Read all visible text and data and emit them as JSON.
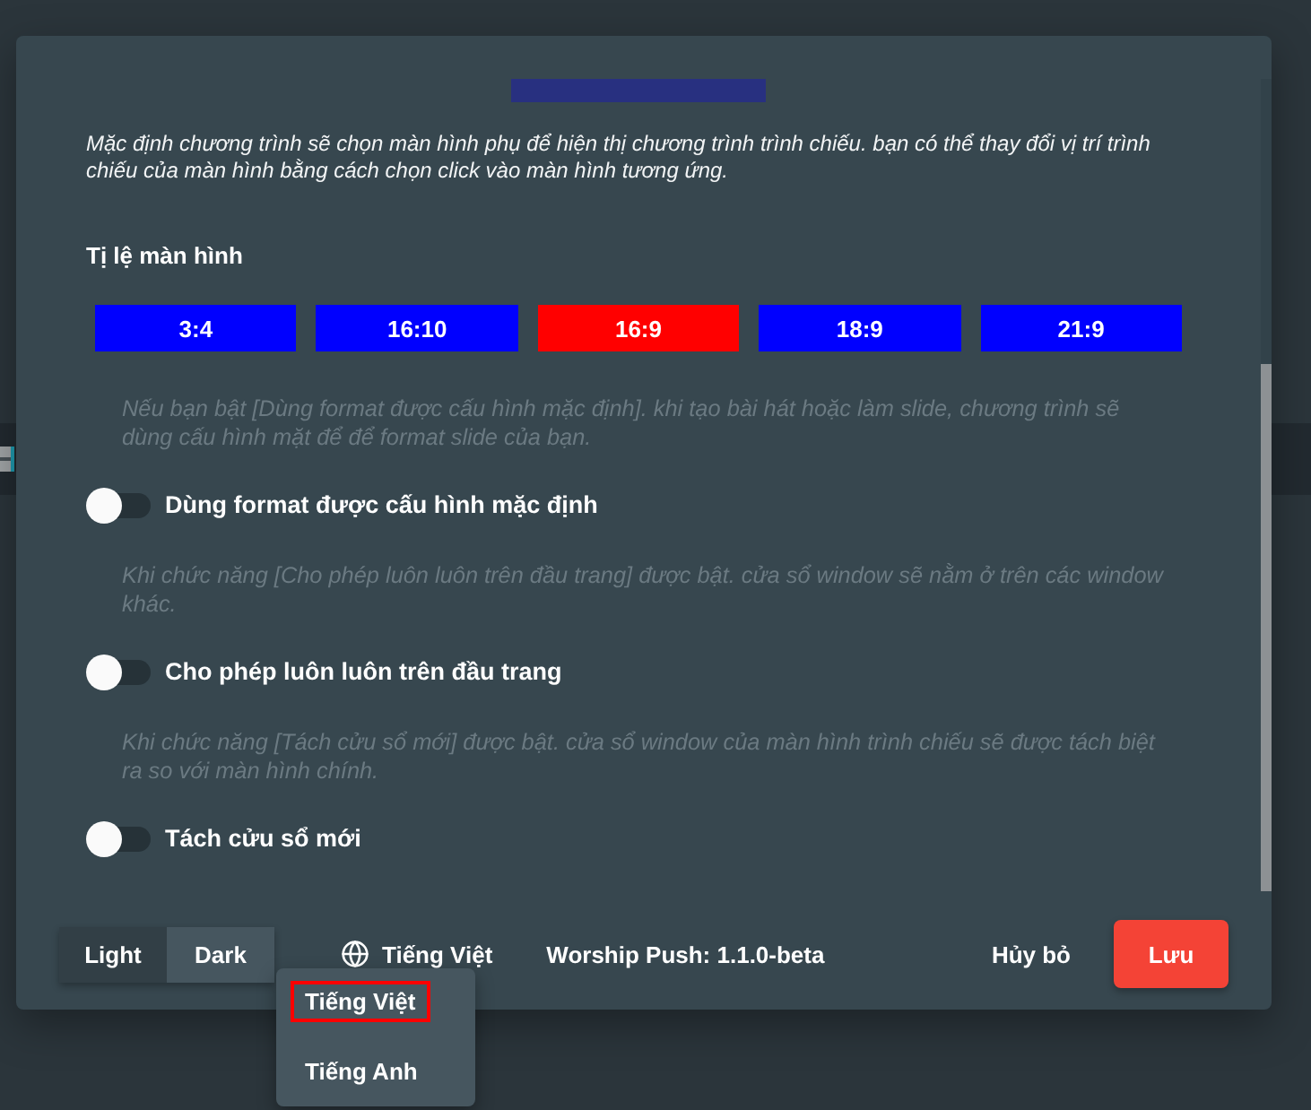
{
  "description": "Mặc định chương trình sẽ chọn màn hình phụ để hiện thị chương trình trình chiếu. bạn có thể thay đổi vị trí trình chiếu của màn hình bằng cách chọn click vào màn hình tương ứng.",
  "aspect_ratio": {
    "title": "Tị lệ màn hình",
    "options": [
      {
        "label": "3:4",
        "selected": false
      },
      {
        "label": "16:10",
        "selected": false
      },
      {
        "label": "16:9",
        "selected": true
      },
      {
        "label": "18:9",
        "selected": false
      },
      {
        "label": "21:9",
        "selected": false
      }
    ]
  },
  "settings": [
    {
      "hint": "Nếu bạn bật [Dùng format được cấu hình mặc định]. khi tạo bài hát hoặc làm slide, chương trình sẽ dùng cấu hình mặt để để format slide của bạn.",
      "label": "Dùng format được cấu hình mặc định",
      "on": false
    },
    {
      "hint": "Khi chức năng [Cho phép luôn luôn trên đầu trang] được bật. cửa sổ window sẽ nằm ở trên các window khác.",
      "label": "Cho phép luôn luôn trên đầu trang",
      "on": false
    },
    {
      "hint": "Khi chức năng [Tách cửu sổ mới] được bật. cửa sổ window của màn hình trình chiếu sẽ được tách biệt ra so với màn hình chính.",
      "label": "Tách cửu sổ mới",
      "on": false
    }
  ],
  "footer": {
    "theme": [
      {
        "label": "Light",
        "selected": false
      },
      {
        "label": "Dark",
        "selected": true
      }
    ],
    "language": "Tiếng Việt",
    "version": "Worship Push: 1.1.0-beta",
    "cancel": "Hủy bỏ",
    "save": "Lưu"
  },
  "language_menu": [
    {
      "label": "Tiếng Việt",
      "selected": true
    },
    {
      "label": "Tiếng Anh",
      "selected": false
    }
  ]
}
